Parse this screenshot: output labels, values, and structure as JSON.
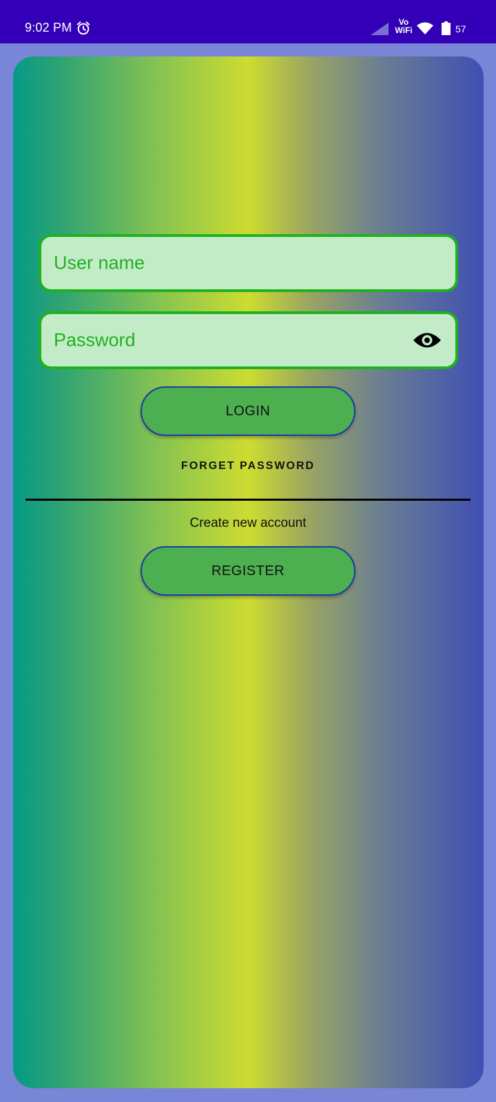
{
  "status_bar": {
    "time": "9:02 PM",
    "network_label": "Vo\nWiFi",
    "network_line1": "Vo",
    "network_line2": "WiFi",
    "battery_level": "57",
    "icons": [
      "alarm-icon",
      "signal-icon",
      "wifi-icon",
      "battery-icon"
    ]
  },
  "login_form": {
    "username_placeholder": "User name",
    "password_placeholder": "Password",
    "password_toggle_icon": "eye-icon",
    "login_label": "LOGIN",
    "forget_password_label": "FORGET PASSWORD",
    "create_account_text": "Create new account",
    "register_label": "REGISTER"
  },
  "colors": {
    "status_bar": "#3300b7",
    "page_background": "#7985d6",
    "input_fill": "#c3ebc8",
    "input_border": "#1eb21e",
    "placeholder_text": "#1fb21f",
    "button_fill": "#4caf50",
    "button_border": "#1a3aa8",
    "gradient": [
      "#049a86",
      "#cddc30",
      "#3f4fb4"
    ]
  }
}
